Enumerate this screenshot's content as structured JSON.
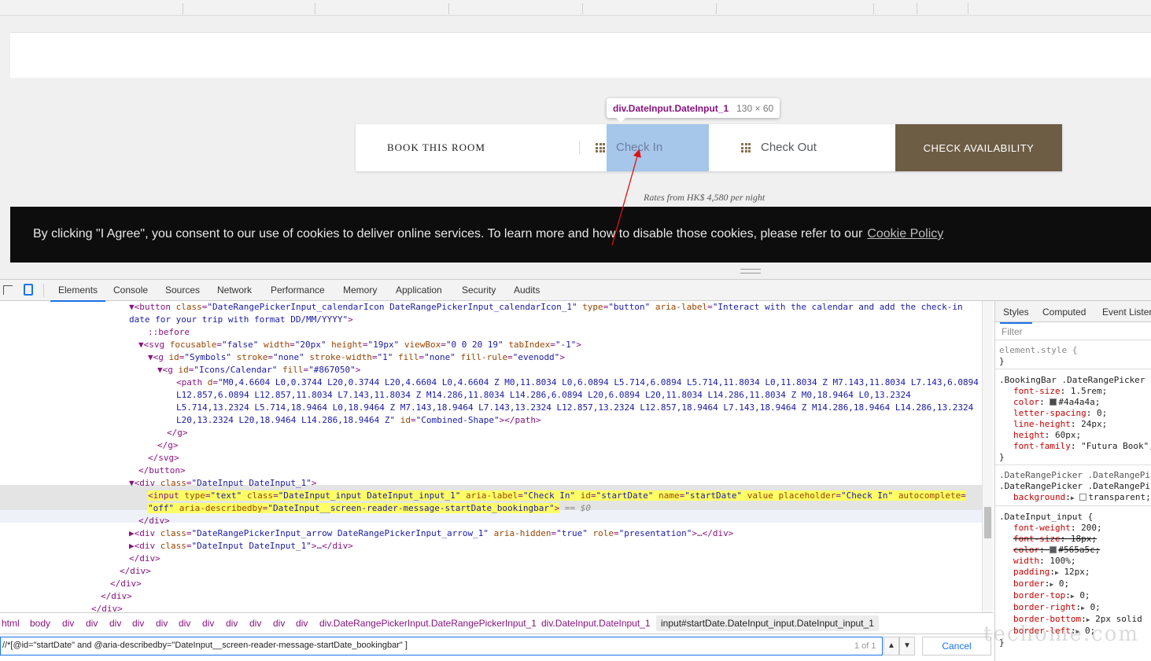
{
  "page": {
    "booking": {
      "title": "BOOK THIS ROOM",
      "check_in": "Check In",
      "check_out": "Check Out",
      "check_availability": "CHECK AVAILABILITY",
      "rates": "Rates from HK$ 4,580 per night"
    },
    "inspector_tooltip": {
      "element": "div.DateInput.DateInput_1",
      "size": "130 × 60"
    },
    "cookie": {
      "text": "By clicking \"I Agree\", you consent to our use of cookies to deliver online services. To learn more and how to disable those cookies, please refer to our",
      "link": "Cookie Policy"
    }
  },
  "devtools": {
    "tabs": [
      "Elements",
      "Console",
      "Sources",
      "Network",
      "Performance",
      "Memory",
      "Application",
      "Security",
      "Audits"
    ],
    "active_tab": "Elements",
    "breadcrumbs": [
      "html",
      "body",
      "div",
      "div",
      "div",
      "div",
      "div",
      "div",
      "div",
      "div",
      "div",
      "div",
      "div",
      "div.DateRangePickerInput.DateRangePickerInput_1",
      "div.DateInput.DateInput_1",
      "input#startDate.DateInput_input.DateInput_input_1"
    ],
    "search": {
      "query": "//*[@id=\"startDate\" and @aria-describedby=\"DateInput__screen-reader-message-startDate_bookingbar\" ]",
      "count": "1 of 1",
      "up": "▲",
      "down": "▼",
      "cancel": "Cancel"
    },
    "dom": {
      "l1_open": "▼<button ",
      "l1_a1n": "class",
      "l1_a1v": "\"DateRangePickerInput_calendarIcon DateRangePickerInput_calendarIcon_1\"",
      "l1_a2n": "type",
      "l1_a2v": "\"button\"",
      "l1_a3n": "aria-label",
      "l1_a3v": "\"Interact with the calendar and add the check-in",
      "l2_text": "date for your trip with format DD/MM/YYYY\"",
      "l2_close": ">",
      "l3": "::before",
      "l4_open": "▼<svg ",
      "l4_attrs": [
        {
          "n": "focusable",
          "v": "\"false\""
        },
        {
          "n": "width",
          "v": "\"20px\""
        },
        {
          "n": "height",
          "v": "\"19px\""
        },
        {
          "n": "viewBox",
          "v": "\"0 0 20 19\""
        },
        {
          "n": "tabIndex",
          "v": "\"-1\""
        }
      ],
      "l5_open": "▼<g ",
      "l5_attrs": [
        {
          "n": "id",
          "v": "\"Symbols\""
        },
        {
          "n": "stroke",
          "v": "\"none\""
        },
        {
          "n": "stroke-width",
          "v": "\"1\""
        },
        {
          "n": "fill",
          "v": "\"none\""
        },
        {
          "n": "fill-rule",
          "v": "\"evenodd\""
        }
      ],
      "l6_open": "▼<g ",
      "l6_attrs": [
        {
          "n": "id",
          "v": "\"Icons/Calendar\""
        },
        {
          "n": "fill",
          "v": "\"#867050\""
        }
      ],
      "l7_open": "<path ",
      "l7_an": "d",
      "l7_av": "\"M0,4.6604 L0,0.3744 L20,0.3744 L20,4.6604 L0,4.6604 Z M0,11.8034 L0,6.0894 L5.714,6.0894 L5.714,11.8034 L0,11.8034 Z M7.143,11.8034 L7.143,6.0894",
      "l8": "L12.857,6.0894 L12.857,11.8034 L7.143,11.8034 Z M14.286,11.8034 L14.286,6.0894 L20,6.0894 L20,11.8034 L14.286,11.8034 Z M0,18.9464 L0,13.2324",
      "l9": "L5.714,13.2324 L5.714,18.9464 L0,18.9464 Z M7.143,18.9464 L7.143,13.2324 L12.857,13.2324 L12.857,18.9464 L7.143,18.9464 Z M14.286,18.9464 L14.286,13.2324",
      "l10_path": "L20,13.2324 L20,18.9464 L14.286,18.9464 Z\"",
      "l10_idn": "id",
      "l10_idv": "\"Combined-Shape\"",
      "l10_close": "></path>",
      "l11": "</g>",
      "l12": "</g>",
      "l13": "</svg>",
      "l14": "</button>",
      "l15_open": "▼<div ",
      "l15_an": "class",
      "l15_av": "\"DateInput DateInput_1\"",
      "l15_close": ">",
      "l16_open": "<input ",
      "l16_attrs": [
        {
          "n": "type",
          "v": "\"text\""
        },
        {
          "n": "class",
          "v": "\"DateInput_input DateInput_input_1\""
        },
        {
          "n": "aria-label",
          "v": "\"Check In\""
        },
        {
          "n": "id",
          "v": "\"startDate\""
        },
        {
          "n": "name",
          "v": "\"startDate\""
        },
        {
          "n": "value",
          "v": ""
        },
        {
          "n": "placeholder",
          "v": "\"Check In\""
        },
        {
          "n": "autocomplete",
          "v": ""
        }
      ],
      "l17_autov": "\"off\"",
      "l17_an": "aria-describedby",
      "l17_av": "\"DateInput__screen-reader-message-startDate_bookingbar\"",
      "l17_close": ">",
      "l17_eq": "== $0",
      "l18": "</div>",
      "l19_open": "▶<div ",
      "l19_a1n": "class",
      "l19_a1v": "\"DateRangePickerInput_arrow DateRangePickerInput_arrow_1\"",
      "l19_a2n": "aria-hidden",
      "l19_a2v": "\"true\"",
      "l19_a3n": "role",
      "l19_a3v": "\"presentation\"",
      "l19_close": ">…</div>",
      "l20_open": "▶<div ",
      "l20_an": "class",
      "l20_av": "\"DateInput DateInput_1\"",
      "l20_close": ">…</div>",
      "l21": "</div>",
      "l22": "</div>",
      "l23": "</div>",
      "l24": "</div>",
      "l25": "</div>"
    }
  },
  "styles_pane": {
    "tabs": [
      "Styles",
      "Computed",
      "Event Listeners"
    ],
    "filter": "Filter",
    "element_style": "element.style {",
    "close_brace": "}",
    "rule1": {
      "selector": ".BookingBar .DateRangePicker :",
      "props": [
        {
          "n": "font-size",
          "v": "1.5rem;"
        },
        {
          "n": "color",
          "v": "#4a4a4a;",
          "swatch": "#4a4a4a"
        },
        {
          "n": "letter-spacing",
          "v": "0;"
        },
        {
          "n": "line-height",
          "v": "24px;"
        },
        {
          "n": "height",
          "v": "60px;"
        },
        {
          "n": "font-family",
          "v": "\"Futura Book\","
        }
      ]
    },
    "rule2": {
      "selector1": ".DateRangePicker .DateRangePic",
      "selector2": ".DateRangePicker .DateRangePic",
      "prop_n": "background",
      "prop_v": "transparent;"
    },
    "rule3": {
      "selector": ".DateInput_input {",
      "props": [
        {
          "n": "font-weight",
          "v": "200;",
          "strike": false
        },
        {
          "n": "font-size",
          "v": "18px;",
          "strike": true
        },
        {
          "n": "color",
          "v": "#565a5c;",
          "strike": true,
          "swatch": "#565a5c"
        },
        {
          "n": "width",
          "v": "100%;",
          "strike": false
        },
        {
          "n": "padding",
          "v": "12px;",
          "strike": false,
          "tri": true
        },
        {
          "n": "border",
          "v": "0;",
          "strike": false,
          "tri": true
        },
        {
          "n": "border-top",
          "v": "0;",
          "strike": false,
          "tri": true
        },
        {
          "n": "border-right",
          "v": "0;",
          "strike": false,
          "tri": true
        },
        {
          "n": "border-bottom",
          "v": "2px solid",
          "strike": false,
          "tri": true
        },
        {
          "n": "border-left",
          "v": "0;",
          "strike": false,
          "tri": true
        }
      ]
    }
  },
  "watermark": "techome.com",
  "colors": {
    "accent": "#867050",
    "check_availability_bg": "#6e5d45",
    "highlight": "#a6c6ea",
    "devtools_blue": "#1a73e8",
    "tag": "#881280",
    "attr_name": "#994500",
    "attr_value": "#1a1aa6"
  }
}
